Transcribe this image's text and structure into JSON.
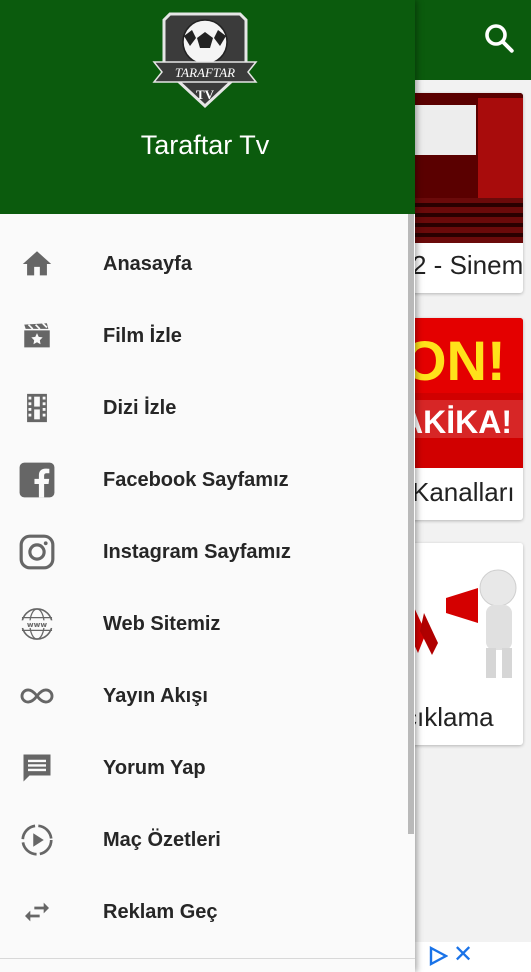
{
  "app": {
    "colors": {
      "primary": "#0b5b0d",
      "accent": "#1a73e8",
      "text": "#262626",
      "icon": "#666666"
    },
    "search_icon": "search-icon"
  },
  "background_cards": [
    {
      "caption": "2 - Sinem"
    },
    {
      "caption": "Kanalları",
      "image_text_1": "ON!",
      "image_text_2": "AKİKA!"
    },
    {
      "caption": "çıklama"
    }
  ],
  "ad": {
    "play_icon": "ad-choices-icon",
    "close_glyph": "✕"
  },
  "drawer": {
    "logo": {
      "banner_text": "TARAFTAR",
      "sub_text": "TV"
    },
    "title": "Taraftar Tv",
    "items": [
      {
        "label": "Anasayfa",
        "icon": "home-icon"
      },
      {
        "label": "Film İzle",
        "icon": "movie-icon"
      },
      {
        "label": "Dizi İzle",
        "icon": "film-strip-icon"
      },
      {
        "label": "Facebook Sayfamız",
        "icon": "facebook-icon"
      },
      {
        "label": "Instagram Sayfamız",
        "icon": "instagram-icon"
      },
      {
        "label": "Web Sitemiz",
        "icon": "www-globe-icon"
      },
      {
        "label": "Yayın Akışı",
        "icon": "infinity-icon"
      },
      {
        "label": "Yorum Yap",
        "icon": "comment-icon"
      },
      {
        "label": "Maç Özetleri",
        "icon": "play-circle-icon"
      },
      {
        "label": "Reklam Geç",
        "icon": "swap-arrows-icon"
      }
    ]
  }
}
